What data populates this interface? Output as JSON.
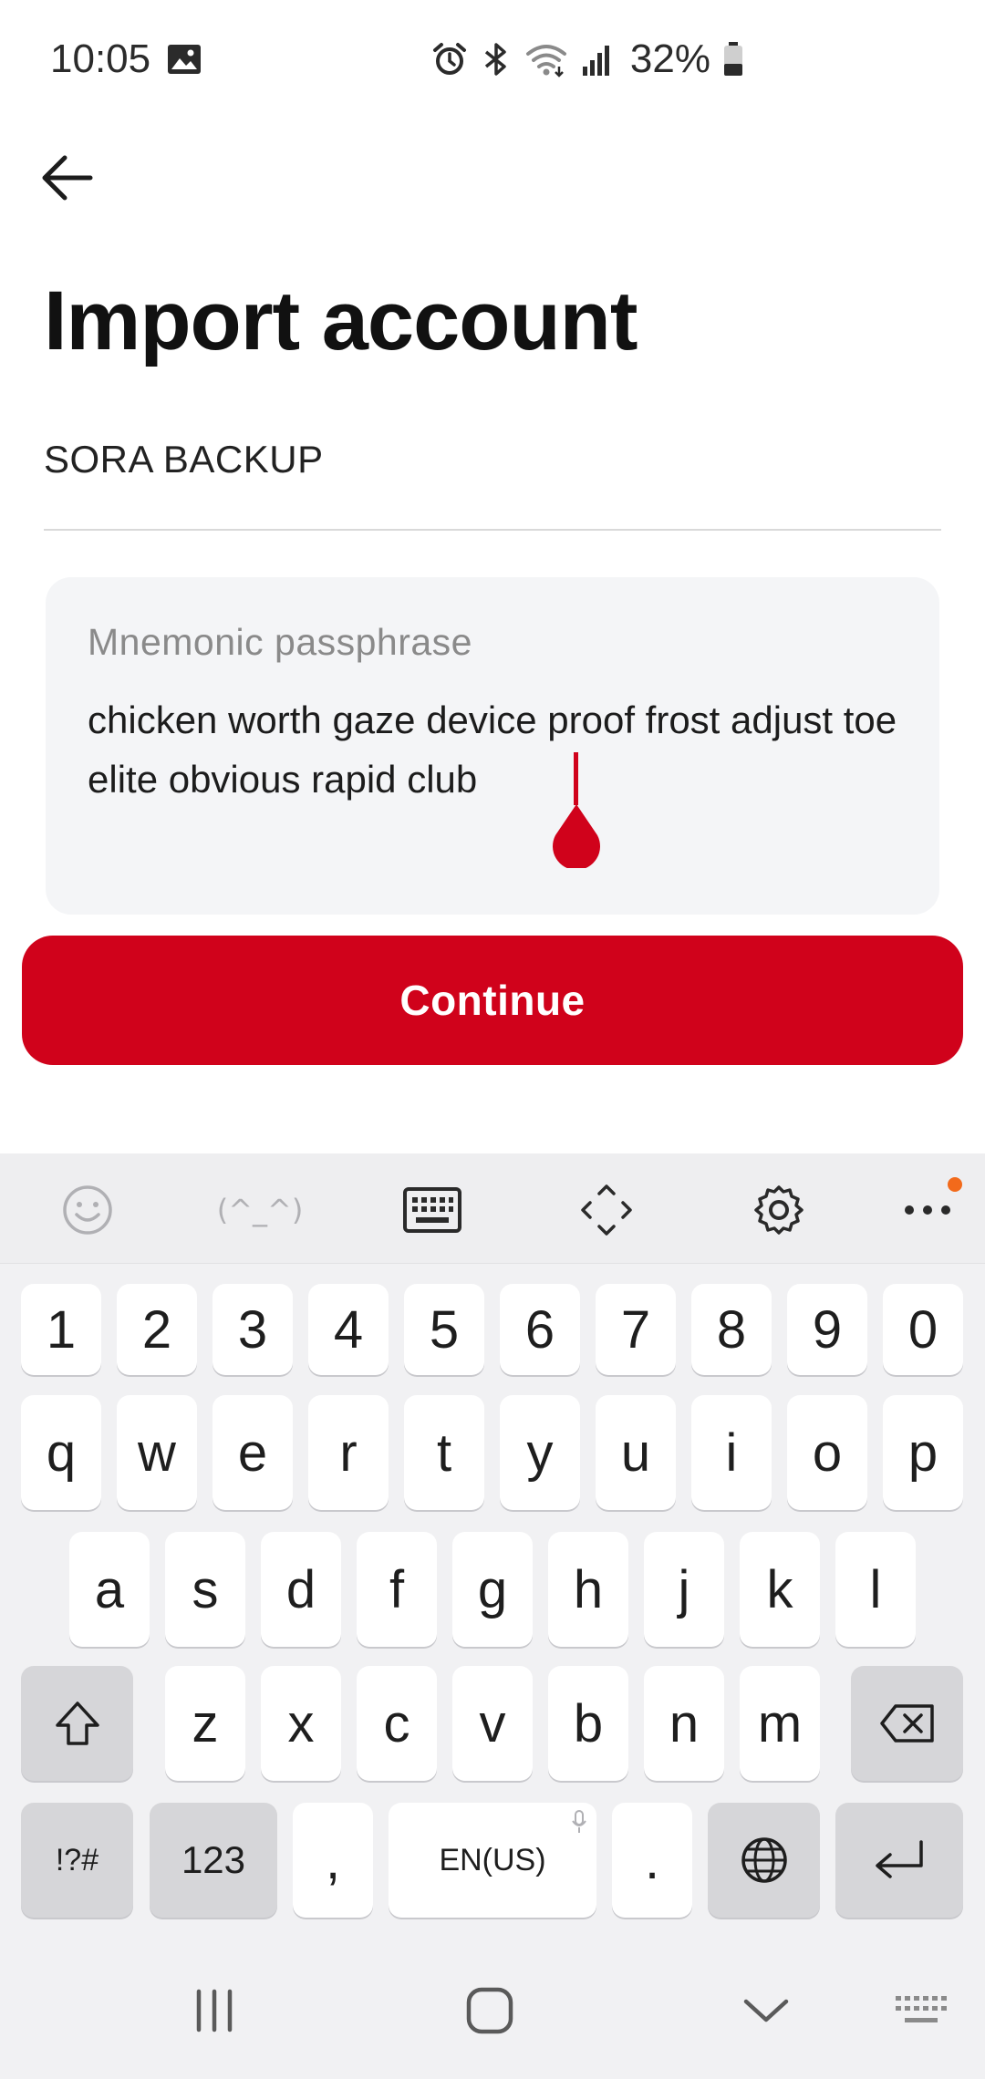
{
  "status_bar": {
    "time": "10:05",
    "battery": "32%",
    "icons": [
      "gallery-icon",
      "alarm-icon",
      "bluetooth-icon",
      "wifi-icon",
      "signal-icon",
      "battery-icon"
    ]
  },
  "header": {
    "back_icon": "arrow-left-icon",
    "title": "Import account"
  },
  "form": {
    "account_name": "SORA BACKUP",
    "mnemonic_label": "Mnemonic passphrase",
    "mnemonic_value": "chicken worth gaze device proof frost adjust toe elite obvious rapid club"
  },
  "continue_button": {
    "label": "Continue"
  },
  "keyboard": {
    "toolbar": {
      "kaomoji": "(^_^)",
      "icons": [
        "emoji-icon",
        "kaomoji-icon",
        "keyboard-icon",
        "move-icon",
        "settings-icon",
        "more-icon"
      ]
    },
    "row_numbers": [
      "1",
      "2",
      "3",
      "4",
      "5",
      "6",
      "7",
      "8",
      "9",
      "0"
    ],
    "row1": [
      "q",
      "w",
      "e",
      "r",
      "t",
      "y",
      "u",
      "i",
      "o",
      "p"
    ],
    "row2": [
      "a",
      "s",
      "d",
      "f",
      "g",
      "h",
      "j",
      "k",
      "l"
    ],
    "row3": [
      "z",
      "x",
      "c",
      "v",
      "b",
      "n",
      "m"
    ],
    "symbols_label": "!?#",
    "numbers_label": "123",
    "comma": ",",
    "space_label": "EN(US)",
    "period": "."
  },
  "colors": {
    "accent": "#d0021b",
    "input_bg": "#f4f5f7",
    "keyboard_bg": "#f1f1f3"
  }
}
